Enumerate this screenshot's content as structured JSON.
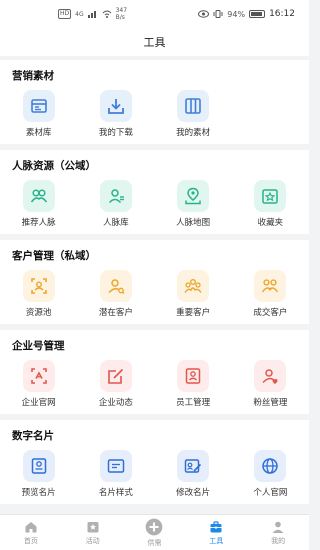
{
  "status_bar": {
    "hd_label": "HD",
    "signal_label": "4G",
    "net_speed": "347",
    "net_unit": "B/s",
    "battery": "94%",
    "time": "16:12"
  },
  "header": {
    "title": "工具"
  },
  "sections": [
    {
      "title": "营销素材",
      "items": [
        {
          "label": "素材库",
          "icon": "material-library-icon",
          "color": "#3f7fd8"
        },
        {
          "label": "我的下载",
          "icon": "download-icon",
          "color": "#3f7fd8"
        },
        {
          "label": "我的素材",
          "icon": "my-material-icon",
          "color": "#3f7fd8"
        }
      ]
    },
    {
      "title": "人脉资源（公域）",
      "items": [
        {
          "label": "推荐人脉",
          "icon": "recommend-contacts-icon",
          "color": "#26b38a"
        },
        {
          "label": "人脉库",
          "icon": "contacts-library-icon",
          "color": "#26b38a"
        },
        {
          "label": "人脉地图",
          "icon": "contacts-map-icon",
          "color": "#26b38a"
        },
        {
          "label": "收藏夹",
          "icon": "favorites-icon",
          "color": "#26b38a"
        }
      ]
    },
    {
      "title": "客户管理（私域）",
      "items": [
        {
          "label": "资源池",
          "icon": "resource-pool-icon",
          "color": "#eea62a"
        },
        {
          "label": "潜在客户",
          "icon": "potential-customer-icon",
          "color": "#eea62a"
        },
        {
          "label": "重要客户",
          "icon": "key-customer-icon",
          "color": "#eea62a"
        },
        {
          "label": "成交客户",
          "icon": "closed-customer-icon",
          "color": "#eea62a"
        }
      ]
    },
    {
      "title": "企业号管理",
      "items": [
        {
          "label": "企业官网",
          "icon": "company-website-icon",
          "color": "#e2574c"
        },
        {
          "label": "企业动态",
          "icon": "company-news-icon",
          "color": "#e2574c"
        },
        {
          "label": "员工管理",
          "icon": "staff-management-icon",
          "color": "#e2574c"
        },
        {
          "label": "粉丝管理",
          "icon": "fans-management-icon",
          "color": "#e2574c"
        }
      ]
    },
    {
      "title": "数字名片",
      "items": [
        {
          "label": "预览名片",
          "icon": "preview-card-icon",
          "color": "#2f6fd6"
        },
        {
          "label": "名片样式",
          "icon": "card-style-icon",
          "color": "#2f6fd6"
        },
        {
          "label": "修改名片",
          "icon": "edit-card-icon",
          "color": "#2f6fd6"
        },
        {
          "label": "个人官网",
          "icon": "personal-website-icon",
          "color": "#2f6fd6"
        }
      ]
    }
  ],
  "tabbar": {
    "items": [
      {
        "label": "首页",
        "icon": "home-icon"
      },
      {
        "label": "活动",
        "icon": "activity-icon"
      },
      {
        "label": "供需",
        "icon": "supply-demand-icon"
      },
      {
        "label": "工具",
        "icon": "toolbox-icon",
        "active": true
      },
      {
        "label": "我的",
        "icon": "profile-icon"
      }
    ],
    "active_color": "#1e88e5",
    "inactive_color": "#b0b0b0"
  }
}
